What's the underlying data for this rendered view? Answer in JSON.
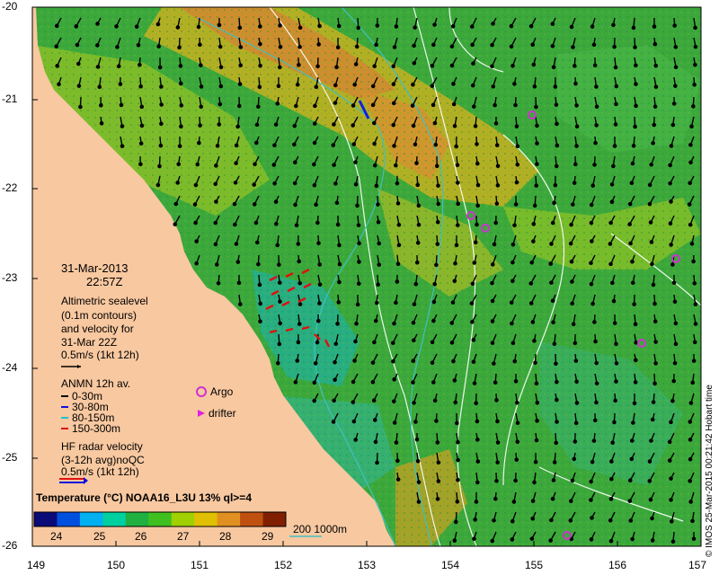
{
  "map": {
    "lat_labels": [
      "-20",
      "-21",
      "-22",
      "-23",
      "-24",
      "-25",
      "-26"
    ],
    "lon_labels": [
      "149",
      "150",
      "151",
      "152",
      "153",
      "154",
      "155",
      "156",
      "157"
    ],
    "date": "31-Mar-2013",
    "time": "22:57Z",
    "credit": "© IMOS 25-Mar-2015 00:21:42 Hobart time"
  },
  "legend": {
    "altimetry_lines": [
      "Altimetric sealevel",
      "(0.1m contours)",
      "and velocity for",
      "31-Mar 22Z"
    ],
    "altimetry_scale": "0.5m/s (1kt 12h)",
    "anmn_title": "ANMN 12h av.",
    "anmn_depths": [
      {
        "label": "0-30m",
        "color": "#000000"
      },
      {
        "label": "30-80m",
        "color": "#1010e0"
      },
      {
        "label": "80-150m",
        "color": "#20c0d0"
      },
      {
        "label": "150-300m",
        "color": "#e01010"
      }
    ],
    "argo_label": "Argo",
    "drifter_label": "drifter",
    "hf_lines": [
      "HF radar velocity",
      "(3-12h avg)noQC"
    ],
    "hf_scale": "0.5m/s (1kt 12h)",
    "bathy_label": "200  1000m"
  },
  "colorbar": {
    "title": "Temperature (°C) NOAA16_L3U 13% ql>=4",
    "ticks": [
      "24",
      "25",
      "26",
      "27",
      "28",
      "29"
    ],
    "colors": [
      "#0a0a78",
      "#0050e0",
      "#00b0f0",
      "#00d0a0",
      "#20b040",
      "#40c020",
      "#a0d000",
      "#e0c000",
      "#e09020",
      "#c05010",
      "#802000"
    ]
  },
  "colors": {
    "land": "#f8c8a0",
    "argo": "#d030d0",
    "drifter": "#e020e0",
    "isobath": "#40c0c0",
    "contour": "#ffffff"
  }
}
